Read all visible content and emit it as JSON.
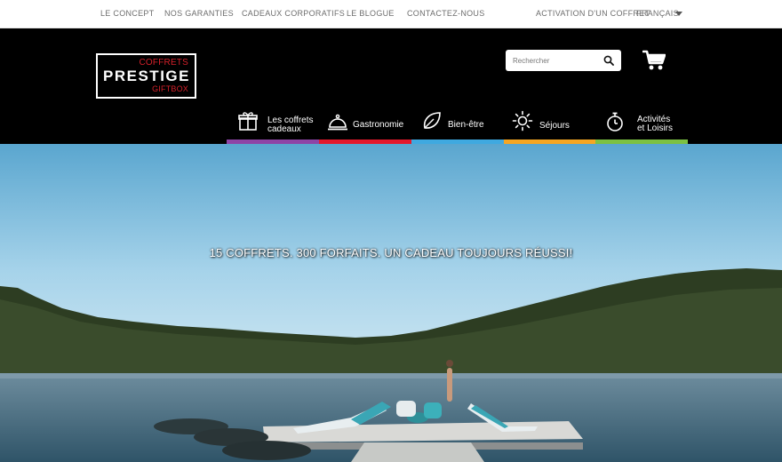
{
  "topbar": {
    "links": [
      "LE CONCEPT",
      "NOS GARANTIES",
      "CADEAUX CORPORATIFS",
      "LE BLOGUE",
      "CONTACTEZ-NOUS"
    ],
    "activation": "ACTIVATION D'UN COFFRET",
    "language": "FRANÇAIS"
  },
  "logo": {
    "top": "COFFRETS",
    "main": "PRESTIGE",
    "bottom": "GIFTBOX"
  },
  "search": {
    "placeholder": "Rechercher"
  },
  "nav": [
    {
      "line1": "Les coffrets",
      "line2": "cadeaux",
      "icon": "gift-icon",
      "color": "#8e44a6"
    },
    {
      "line1": "Gastronomie",
      "line2": "",
      "icon": "cloche-icon",
      "color": "#e3192c"
    },
    {
      "line1": "Bien-être",
      "line2": "",
      "icon": "leaf-icon",
      "color": "#3fa9e0"
    },
    {
      "line1": "Séjours",
      "line2": "",
      "icon": "sun-icon",
      "color": "#f5a623"
    },
    {
      "line1": "Activités",
      "line2": "et Loisirs",
      "icon": "stopwatch-icon",
      "color": "#7cc142"
    }
  ],
  "hero": {
    "tagline": "15 COFFRETS. 300 FORFAITS. UN CADEAU TOUJOURS RÉUSSI!"
  },
  "colors": {
    "header_bg": "#000000",
    "accent_red": "#d4202a"
  }
}
